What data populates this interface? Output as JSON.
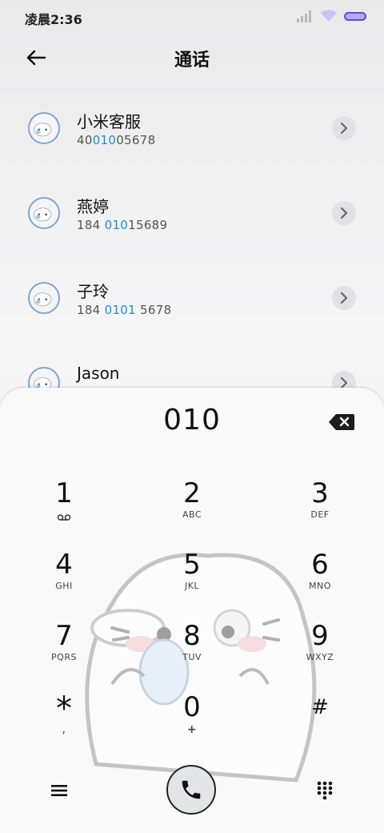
{
  "status": {
    "time": "凌晨2:36"
  },
  "header": {
    "title": "通话"
  },
  "contacts": [
    {
      "name": "小米客服",
      "num_pre": "40",
      "num_hl": "010",
      "num_post": "05678"
    },
    {
      "name": "燕婷",
      "num_pre": "184 ",
      "num_hl": "010",
      "num_post": "15689"
    },
    {
      "name": "子玲",
      "num_pre": "184 ",
      "num_hl": "0101",
      "num_post": " 5678"
    },
    {
      "name": "Jason",
      "num_pre": "",
      "num_hl": "",
      "num_post": ""
    }
  ],
  "dialer": {
    "display": "010",
    "keys": [
      {
        "digit": "1",
        "letters": ""
      },
      {
        "digit": "2",
        "letters": "ABC"
      },
      {
        "digit": "3",
        "letters": "DEF"
      },
      {
        "digit": "4",
        "letters": "GHI"
      },
      {
        "digit": "5",
        "letters": "JKL"
      },
      {
        "digit": "6",
        "letters": "MNO"
      },
      {
        "digit": "7",
        "letters": "PQRS"
      },
      {
        "digit": "8",
        "letters": "TUV"
      },
      {
        "digit": "9",
        "letters": "WXYZ"
      },
      {
        "digit": "*",
        "letters": ","
      },
      {
        "digit": "0",
        "letters": "+"
      },
      {
        "digit": "#",
        "letters": ""
      }
    ]
  },
  "colors": {
    "highlight": "#1a8fd6",
    "battery": "#b8a8ff"
  }
}
